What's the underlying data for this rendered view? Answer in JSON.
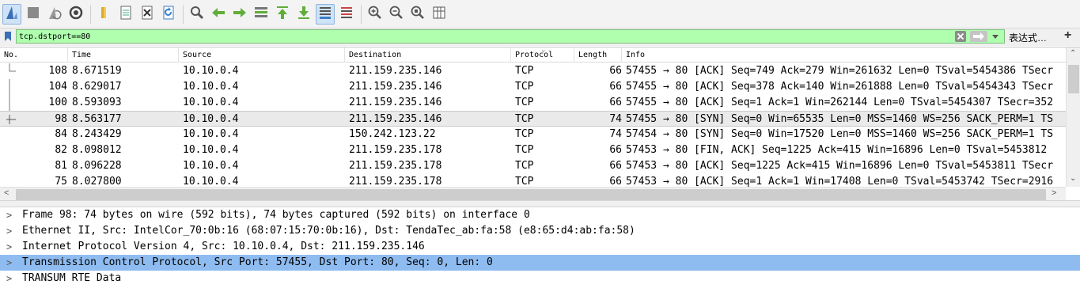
{
  "toolbar": {
    "buttons": [
      {
        "icon": "shark-fin-icon",
        "active": true
      },
      {
        "icon": "stop-icon"
      },
      {
        "icon": "restart-fin-icon"
      },
      {
        "icon": "gear-icon"
      },
      {
        "icon": "folder-icon"
      },
      {
        "icon": "file-icon"
      },
      {
        "icon": "close-file-icon"
      },
      {
        "icon": "reload-icon"
      },
      {
        "icon": "search-icon"
      },
      {
        "icon": "arrow-left-icon"
      },
      {
        "icon": "arrow-right-icon"
      },
      {
        "icon": "go-to-packet-icon"
      },
      {
        "icon": "first-packet-icon"
      },
      {
        "icon": "last-packet-icon"
      },
      {
        "icon": "autoscroll-icon",
        "active": true
      },
      {
        "icon": "colorize-icon"
      },
      {
        "icon": "zoom-in-icon"
      },
      {
        "icon": "zoom-out-icon"
      },
      {
        "icon": "zoom-reset-icon"
      },
      {
        "icon": "resize-columns-icon"
      }
    ]
  },
  "filter": {
    "value": "tcp.dstport==80",
    "expression_label": "表达式…",
    "add_label": "+"
  },
  "packet_list": {
    "columns": [
      "No.",
      "Time",
      "Source",
      "Destination",
      "Protocol",
      "Length",
      "Info"
    ],
    "rows": [
      {
        "no": "108",
        "time": "8.671519",
        "src": "10.10.0.4",
        "dst": "211.159.235.146",
        "proto": "TCP",
        "len": "66",
        "info": "57455 → 80 [ACK] Seq=749 Ack=279 Win=261632 Len=0 TSval=5454386 TSecr",
        "tree": "end"
      },
      {
        "no": "104",
        "time": "8.629017",
        "src": "10.10.0.4",
        "dst": "211.159.235.146",
        "proto": "TCP",
        "len": "66",
        "info": "57455 → 80 [ACK] Seq=378 Ack=140 Win=261888 Len=0 TSval=5454343 TSecr",
        "tree": "line"
      },
      {
        "no": "100",
        "time": "8.593093",
        "src": "10.10.0.4",
        "dst": "211.159.235.146",
        "proto": "TCP",
        "len": "66",
        "info": "57455 → 80 [ACK] Seq=1 Ack=1 Win=262144 Len=0 TSval=5454307 TSecr=352",
        "tree": "line"
      },
      {
        "no": "98",
        "time": "8.563177",
        "src": "10.10.0.4",
        "dst": "211.159.235.146",
        "proto": "TCP",
        "len": "74",
        "info": "57455 → 80 [SYN] Seq=0 Win=65535 Len=0 MSS=1460 WS=256 SACK_PERM=1 TS",
        "tree": "start",
        "selected": true
      },
      {
        "no": "84",
        "time": "8.243429",
        "src": "10.10.0.4",
        "dst": "150.242.123.22",
        "proto": "TCP",
        "len": "74",
        "info": "57454 → 80 [SYN] Seq=0 Win=17520 Len=0 MSS=1460 WS=256 SACK_PERM=1 TS",
        "tree": ""
      },
      {
        "no": "82",
        "time": "8.098012",
        "src": "10.10.0.4",
        "dst": "211.159.235.178",
        "proto": "TCP",
        "len": "66",
        "info": "57453 → 80 [FIN, ACK] Seq=1225 Ack=415 Win=16896 Len=0 TSval=5453812",
        "tree": ""
      },
      {
        "no": "81",
        "time": "8.096228",
        "src": "10.10.0.4",
        "dst": "211.159.235.178",
        "proto": "TCP",
        "len": "66",
        "info": "57453 → 80 [ACK] Seq=1225 Ack=415 Win=16896 Len=0 TSval=5453811 TSecr",
        "tree": ""
      },
      {
        "no": "75",
        "time": "8.027800",
        "src": "10.10.0.4",
        "dst": "211.159.235.178",
        "proto": "TCP",
        "len": "66",
        "info": "57453 → 80 [ACK] Seq=1 Ack=1 Win=17408 Len=0 TSval=5453742 TSecr=2916",
        "tree": ""
      }
    ]
  },
  "details": {
    "rows": [
      {
        "text": "Frame 98: 74 bytes on wire (592 bits), 74 bytes captured (592 bits) on interface 0"
      },
      {
        "text": "Ethernet II, Src: IntelCor_70:0b:16 (68:07:15:70:0b:16), Dst: TendaTec_ab:fa:58 (e8:65:d4:ab:fa:58)"
      },
      {
        "text": "Internet Protocol Version 4, Src: 10.10.0.4, Dst: 211.159.235.146"
      },
      {
        "text": "Transmission Control Protocol, Src Port: 57455, Dst Port: 80, Seq: 0, Len: 0",
        "selected": true
      },
      {
        "text": "TRANSUM RTE Data"
      }
    ]
  },
  "colors": {
    "filter_valid": "#afffaf",
    "selected_detail": "#8fbcf0",
    "selected_row": "#eaeaea"
  }
}
